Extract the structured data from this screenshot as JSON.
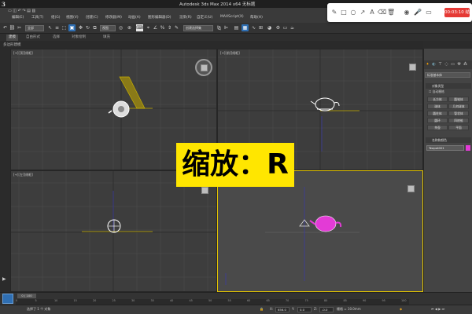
{
  "app": {
    "title": "Autodesk 3ds Max 2014 x64    无标题",
    "logo": "3"
  },
  "window_controls": [
    "—",
    "□",
    "✕"
  ],
  "menu": [
    "编辑(E)",
    "工具(T)",
    "组(G)",
    "视图(V)",
    "创建(C)",
    "修改器(M)",
    "动画(A)",
    "图形编辑器(D)",
    "渲染(R)",
    "自定义(U)",
    "MAXScript(X)",
    "帮助(H)"
  ],
  "toolbar": {
    "selection_filter": "全部",
    "coord_system": "视图",
    "named_selection": "创建选择集"
  },
  "ribbon": {
    "tabs": [
      "建模",
      "自由形式",
      "选择",
      "对象绘制",
      "填充"
    ],
    "sub_label": "多边形建模"
  },
  "viewports": [
    {
      "label": "[+][顶][线框]"
    },
    {
      "label": "[+][前][线框]"
    },
    {
      "label": "[+][左][线框]"
    },
    {
      "label": "[+][透视][真实]"
    }
  ],
  "command_panel": {
    "dropdown": "标准基本体",
    "section_object_type": "对象类型",
    "autogrid": "自动栅格",
    "buttons": [
      "长方体",
      "圆锥体",
      "球体",
      "几何球体",
      "圆柱体",
      "管状体",
      "圆环",
      "四棱锥",
      "茶壶",
      "平面"
    ],
    "section_name_color": "名称和颜色",
    "object_name": "Teapot001",
    "object_color": "#e33bd6"
  },
  "timeline": {
    "frame_counter": "0 / 100",
    "ticks": [
      "0",
      "5",
      "10",
      "15",
      "20",
      "25",
      "30",
      "35",
      "40",
      "45",
      "50",
      "55",
      "60",
      "65",
      "70",
      "75",
      "80",
      "85",
      "90",
      "95",
      "100"
    ]
  },
  "status": {
    "message": "选择了 1 个 对象",
    "x_label": "X:",
    "x_value": "656.0",
    "y_label": "Y:",
    "y_value": "0.0",
    "z_label": "Z:",
    "z_value": "-0.0",
    "grid": "栅格 = 10.0mm"
  },
  "recorder": {
    "time": "00:03:10",
    "stop_label": "结束",
    "tool_icons": [
      "pen-icon",
      "square-icon",
      "circle-icon",
      "arrow-icon",
      "text-icon",
      "eraser-icon",
      "trash-icon",
      "camera-icon",
      "mic-icon",
      "record-icon"
    ]
  },
  "caption": "缩放：R",
  "colors": {
    "active_viewport_border": "#e3c400",
    "caption_bg": "#ffe600",
    "record_button": "#e53935",
    "toolbar_active": "#2f6fb3"
  }
}
